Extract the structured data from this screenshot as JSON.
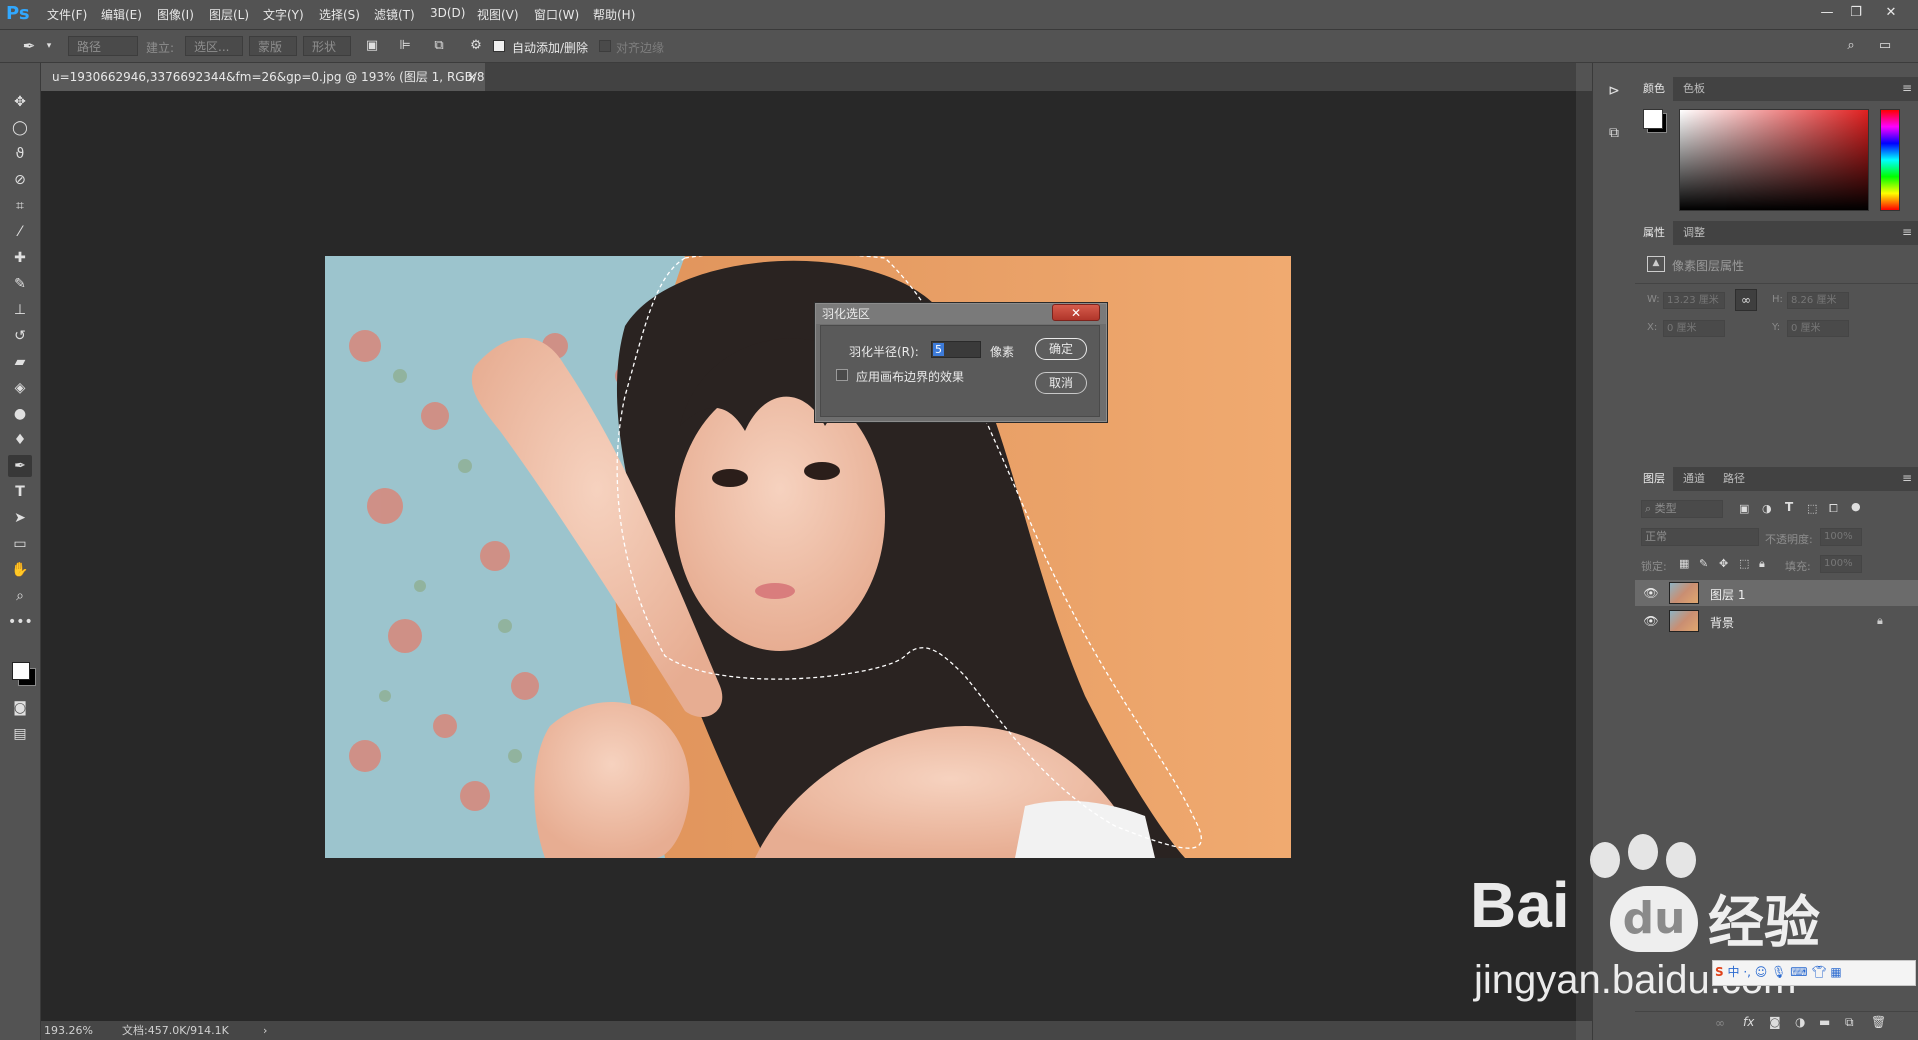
{
  "app": {
    "logo": "Ps"
  },
  "menu": {
    "items": [
      "文件(F)",
      "编辑(E)",
      "图像(I)",
      "图层(L)",
      "文字(Y)",
      "选择(S)",
      "滤镜(T)",
      "3D(D)",
      "视图(V)",
      "窗口(W)",
      "帮助(H)"
    ]
  },
  "window_controls": {
    "minimize": "—",
    "restore": "❐",
    "close": "✕"
  },
  "options_bar": {
    "mode": "路径",
    "build_label": "建立:",
    "selection_btn": "选区...",
    "mask_btn": "蒙版",
    "shape_btn": "形状",
    "auto_add_delete": "自动添加/删除",
    "align_edges": "对齐边缘"
  },
  "document": {
    "tab_title": "u=1930662946,3376692344&fm=26&gp=0.jpg @ 193% (图层 1, RGB/8#) *",
    "tab_close": "×"
  },
  "status": {
    "zoom": "193.26%",
    "doc_size": "文档:457.0K/914.1K",
    "arrow": "›"
  },
  "dialog": {
    "title": "羽化选区",
    "close": "✕",
    "radius_label": "羽化半径(R):",
    "radius_value": "5",
    "unit": "像素",
    "ok": "确定",
    "cancel": "取消",
    "canvas_bounds_label": "应用画布边界的效果"
  },
  "color_panel": {
    "tabs": [
      "颜色",
      "色板"
    ]
  },
  "properties_panel": {
    "tabs": [
      "属性",
      "调整"
    ],
    "title": "像素图层属性",
    "w_label": "W:",
    "w_value": "13.23 厘米",
    "h_label": "H:",
    "h_value": "8.26 厘米",
    "x_label": "X:",
    "x_value": "0 厘米",
    "y_label": "Y:",
    "y_value": "0 厘米"
  },
  "layers_panel": {
    "tabs": [
      "图层",
      "通道",
      "路径"
    ],
    "filter_label": "类型",
    "blend_mode": "正常",
    "opacity_label": "不透明度:",
    "opacity_value": "100%",
    "lock_label": "锁定:",
    "fill_label": "填充:",
    "fill_value": "100%",
    "layers": [
      {
        "name": "图层 1",
        "selected": true
      },
      {
        "name": "背景",
        "locked": true
      }
    ]
  },
  "watermark": {
    "brand": "Bai",
    "brand2": "经验",
    "url": "jingyan.baidu.com"
  },
  "colors": {
    "accent": "#31a8ff",
    "canvas": "#282828",
    "panel": "#535353",
    "close_red": "#c0392b"
  }
}
